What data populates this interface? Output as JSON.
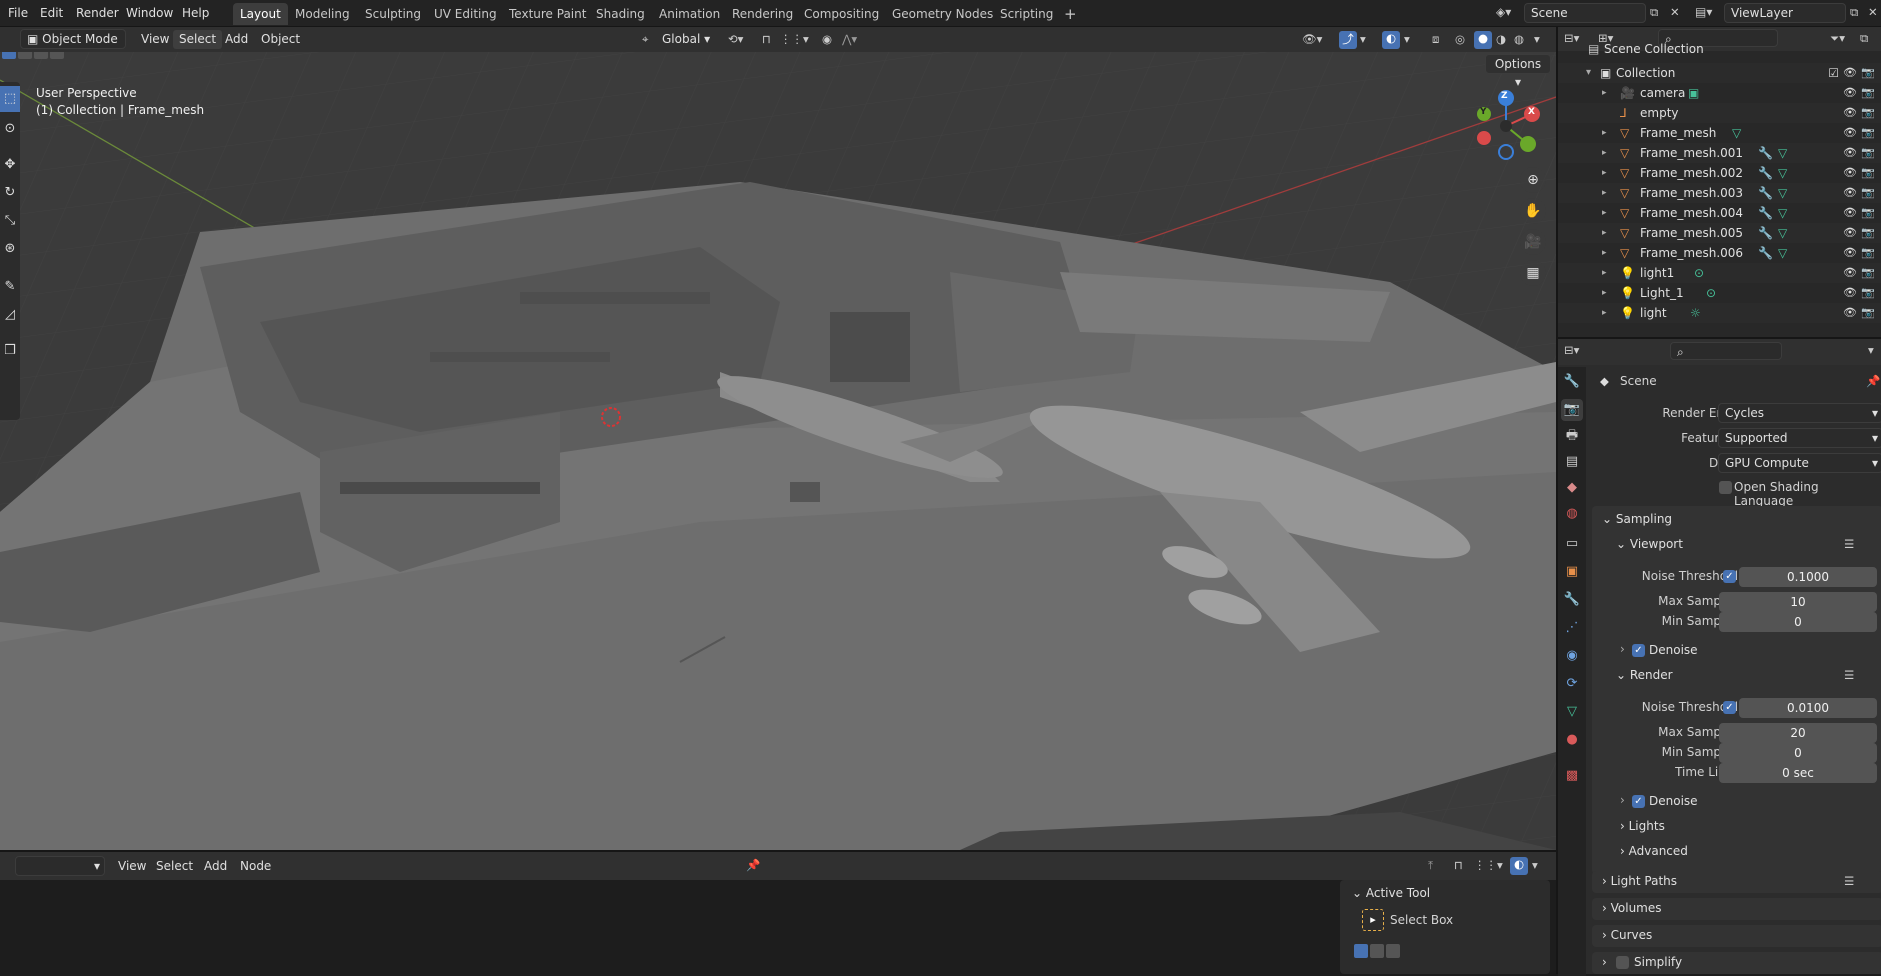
{
  "topbar": {
    "menus": [
      "File",
      "Edit",
      "Render",
      "Window",
      "Help"
    ],
    "workspaces": [
      "Layout",
      "Modeling",
      "Sculpting",
      "UV Editing",
      "Texture Paint",
      "Shading",
      "Animation",
      "Rendering",
      "Compositing",
      "Geometry Nodes",
      "Scripting"
    ],
    "active_workspace": "Layout",
    "scene": "Scene",
    "view_layer": "ViewLayer"
  },
  "viewport_header": {
    "mode": "Object Mode",
    "menus": [
      "View",
      "Select",
      "Add",
      "Object"
    ],
    "transform": "Global",
    "options": "Options"
  },
  "viewport": {
    "perspective": "User Perspective",
    "collection_info": "(1) Collection | Frame_mesh",
    "axes": {
      "x": "X",
      "y": "Y",
      "z": "Z"
    }
  },
  "outliner": {
    "root": "Scene Collection",
    "collection": "Collection",
    "items": [
      {
        "name": "camera"
      },
      {
        "name": "empty"
      },
      {
        "name": "Frame_mesh"
      },
      {
        "name": "Frame_mesh.001"
      },
      {
        "name": "Frame_mesh.002"
      },
      {
        "name": "Frame_mesh.003"
      },
      {
        "name": "Frame_mesh.004"
      },
      {
        "name": "Frame_mesh.005"
      },
      {
        "name": "Frame_mesh.006"
      },
      {
        "name": "light1"
      },
      {
        "name": "Light_1"
      },
      {
        "name": "light"
      }
    ]
  },
  "properties": {
    "context": "Scene",
    "render_engine_label": "Render Engine",
    "render_engine": "Cycles",
    "feature_set_label": "Feature Set",
    "feature_set": "Supported",
    "device_label": "Device",
    "device": "GPU Compute",
    "osl": "Open Shading Language",
    "sampling": "Sampling",
    "viewport": {
      "title": "Viewport",
      "noise_label": "Noise Threshold",
      "noise": "0.1000",
      "max_label": "Max Samples",
      "max": "10",
      "min_label": "Min Samples",
      "min": "0",
      "denoise": "Denoise"
    },
    "render": {
      "title": "Render",
      "noise_label": "Noise Threshold",
      "noise": "0.0100",
      "max_label": "Max Samples",
      "max": "20",
      "min_label": "Min Samples",
      "min": "0",
      "time_label": "Time Limit",
      "time": "0 sec",
      "denoise": "Denoise"
    },
    "subsections": [
      "Lights",
      "Advanced"
    ],
    "panels": [
      "Light Paths",
      "Volumes",
      "Curves",
      "Simplify"
    ]
  },
  "bottom": {
    "menus": [
      "View",
      "Select",
      "Add",
      "Node"
    ],
    "active_tool_title": "Active Tool",
    "active_tool": "Select Box"
  }
}
